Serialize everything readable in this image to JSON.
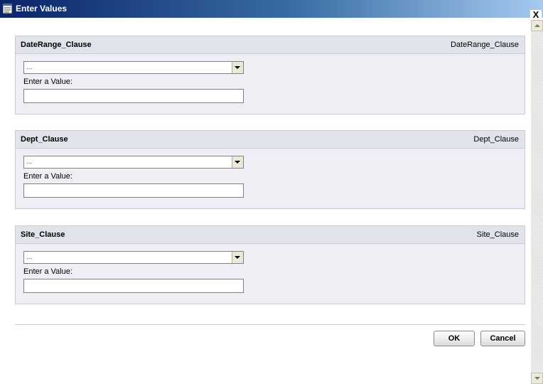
{
  "window": {
    "title": "Enter Values",
    "close_glyph": "X"
  },
  "panels": [
    {
      "title": "DateRange_Clause",
      "right_label": "DateRange_Clause",
      "select_value": "...",
      "value_label": "Enter a Value:",
      "value": ""
    },
    {
      "title": "Dept_Clause",
      "right_label": "Dept_Clause",
      "select_value": "...",
      "value_label": "Enter a Value:",
      "value": ""
    },
    {
      "title": "Site_Clause",
      "right_label": "Site_Clause",
      "select_value": "...",
      "value_label": "Enter a Value:",
      "value": ""
    }
  ],
  "buttons": {
    "ok": "OK",
    "cancel": "Cancel"
  },
  "colors": {
    "titlebar_start": "#0a246a",
    "panel_bg": "#eeeef4",
    "panel_header": "#e1e3ea"
  }
}
